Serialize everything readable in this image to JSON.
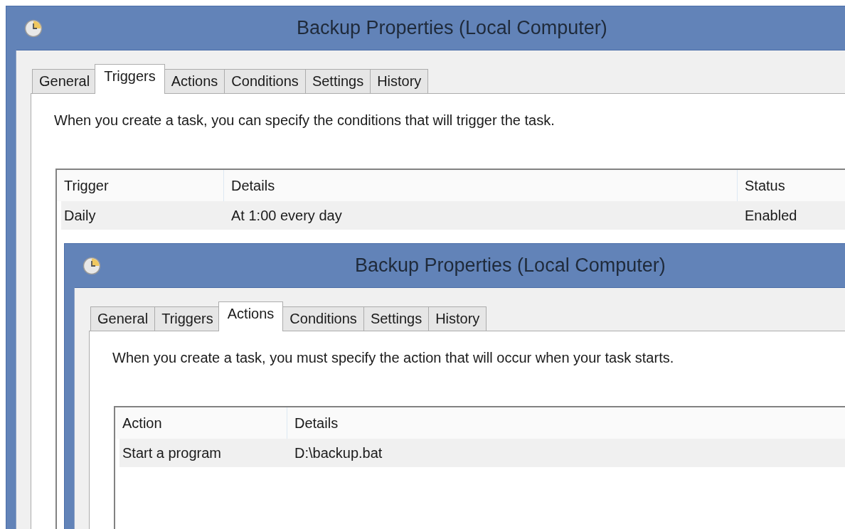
{
  "windows": [
    {
      "title": "Backup Properties (Local Computer)",
      "tabs": [
        {
          "label": "General",
          "selected": false
        },
        {
          "label": "Triggers",
          "selected": true
        },
        {
          "label": "Actions",
          "selected": false
        },
        {
          "label": "Conditions",
          "selected": false
        },
        {
          "label": "Settings",
          "selected": false
        },
        {
          "label": "History",
          "selected": false
        }
      ],
      "description": "When you create a task, you can specify the conditions that will trigger the task.",
      "table": {
        "columns": [
          "Trigger",
          "Details",
          "Status"
        ],
        "rows": [
          {
            "cells": [
              "Daily",
              "At 1:00 every day",
              "Enabled"
            ],
            "selected": true
          }
        ]
      }
    },
    {
      "title": "Backup Properties (Local Computer)",
      "tabs": [
        {
          "label": "General",
          "selected": false
        },
        {
          "label": "Triggers",
          "selected": false
        },
        {
          "label": "Actions",
          "selected": true
        },
        {
          "label": "Conditions",
          "selected": false
        },
        {
          "label": "Settings",
          "selected": false
        },
        {
          "label": "History",
          "selected": false
        }
      ],
      "description": "When you create a task, you must specify the action that will occur when your task starts.",
      "table": {
        "columns": [
          "Action",
          "Details"
        ],
        "rows": [
          {
            "cells": [
              "Start a program",
              "D:\\backup.bat"
            ],
            "selected": true
          }
        ]
      }
    }
  ]
}
